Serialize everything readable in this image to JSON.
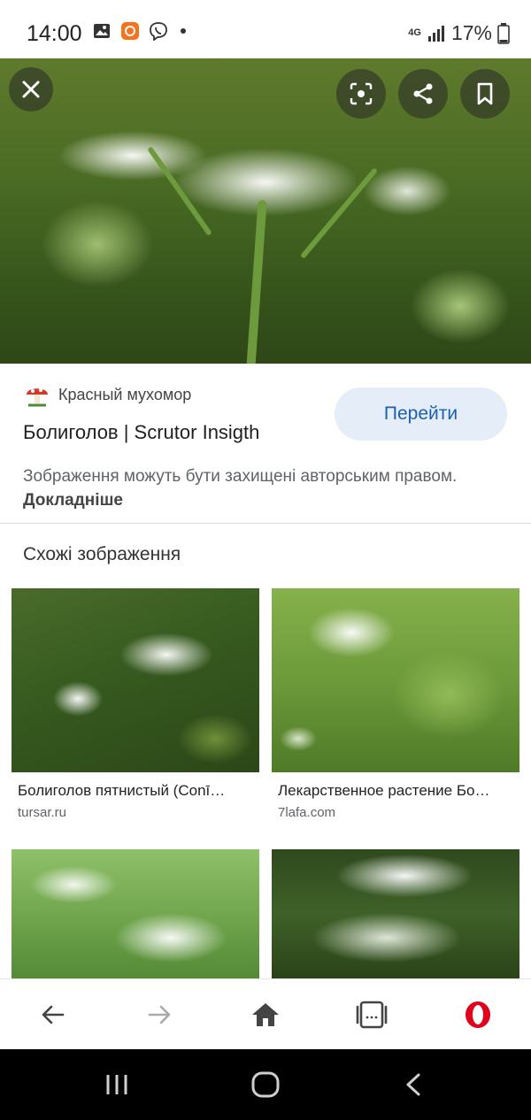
{
  "status": {
    "time": "14:00",
    "network": "4G",
    "battery": "17%"
  },
  "hero": {
    "close_icon": "close-icon",
    "lens_icon": "lens-icon",
    "share_icon": "share-icon",
    "bookmark_icon": "bookmark-icon"
  },
  "result": {
    "source": "Красный мухомор",
    "title": "Болиголов | Scrutor Insigth",
    "go_label": "Перейти",
    "copyright": "Зображення можуть бути захищені авторським правом.",
    "more_label": "Докладніше"
  },
  "similar": {
    "heading": "Схожі зображення",
    "items": [
      {
        "caption": "Болиголов пятнистый (Conī…",
        "domain": "tursar.ru"
      },
      {
        "caption": "Лекарственное растение Бо…",
        "domain": "7lafa.com"
      },
      {
        "caption": "",
        "domain": ""
      },
      {
        "caption": "",
        "domain": ""
      }
    ]
  },
  "nav": {
    "back": "back-icon",
    "forward": "forward-icon",
    "home": "home-icon",
    "tabs": "tabs-icon",
    "opera": "opera-icon"
  },
  "colors": {
    "accent": "#1a5fb4",
    "button_bg": "#e5edf9",
    "opera_red": "#e0001b"
  }
}
